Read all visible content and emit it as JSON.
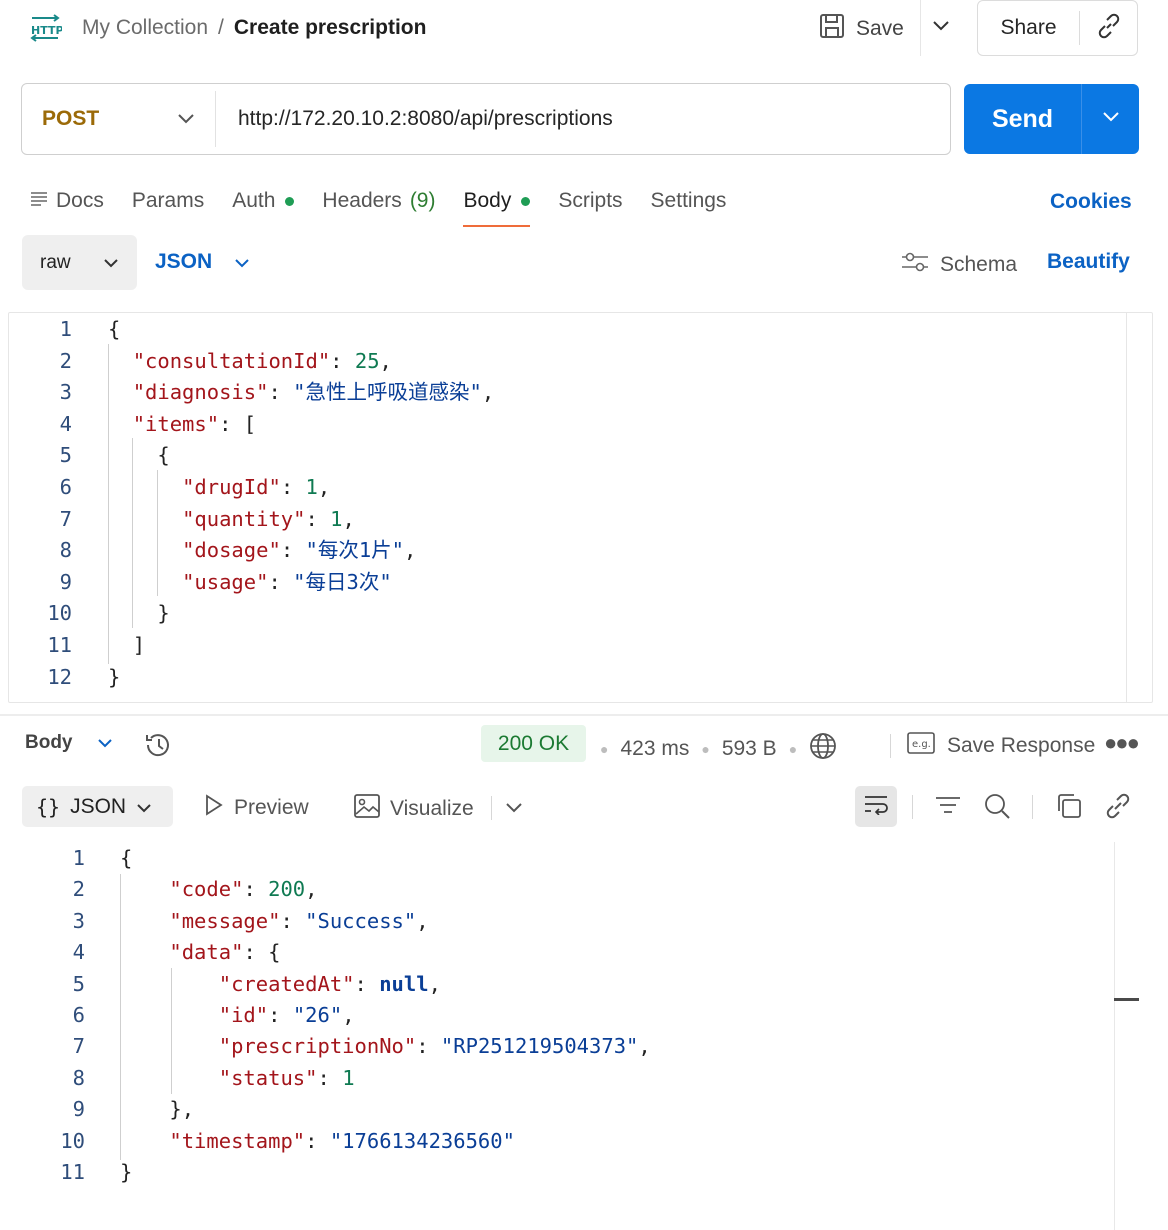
{
  "header": {
    "app_icon": "HTTP",
    "breadcrumb_parent": "My Collection",
    "breadcrumb_sep": "/",
    "breadcrumb_current": "Create prescription",
    "save_label": "Save",
    "share_label": "Share"
  },
  "request": {
    "method": "POST",
    "url": "http://172.20.10.2:8080/api/prescriptions",
    "send_label": "Send"
  },
  "tabs": {
    "docs": "Docs",
    "params": "Params",
    "auth": "Auth",
    "headers": "Headers",
    "headers_count": "(9)",
    "body": "Body",
    "scripts": "Scripts",
    "settings": "Settings",
    "cookies": "Cookies"
  },
  "body_options": {
    "mode": "raw",
    "format": "JSON",
    "schema": "Schema",
    "beautify": "Beautify"
  },
  "request_body_lines": [
    "{",
    "  \"consultationId\": 25,",
    "  \"diagnosis\": \"急性上呼吸道感染\",",
    "  \"items\": [",
    "    {",
    "      \"drugId\": 1,",
    "      \"quantity\": 1,",
    "      \"dosage\": \"每次1片\",",
    "      \"usage\": \"每日3次\"",
    "    }",
    "  ]",
    "}"
  ],
  "response": {
    "body_label": "Body",
    "status": "200 OK",
    "time": "423 ms",
    "size": "593 B",
    "save_response": "Save Response",
    "view_format": "JSON",
    "preview": "Preview",
    "visualize": "Visualize"
  },
  "response_body_lines": [
    "{",
    "    \"code\": 200,",
    "    \"message\": \"Success\",",
    "    \"data\": {",
    "        \"createdAt\": null,",
    "        \"id\": \"26\",",
    "        \"prescriptionNo\": \"RP251219504373\",",
    "        \"status\": 1",
    "    },",
    "    \"timestamp\": \"1766134236560\"",
    "}"
  ],
  "colors": {
    "accent": "#0b78e3",
    "method": "#9b6a08",
    "status_ok": "#1b7a32",
    "active_tab": "#ef6c3a"
  }
}
